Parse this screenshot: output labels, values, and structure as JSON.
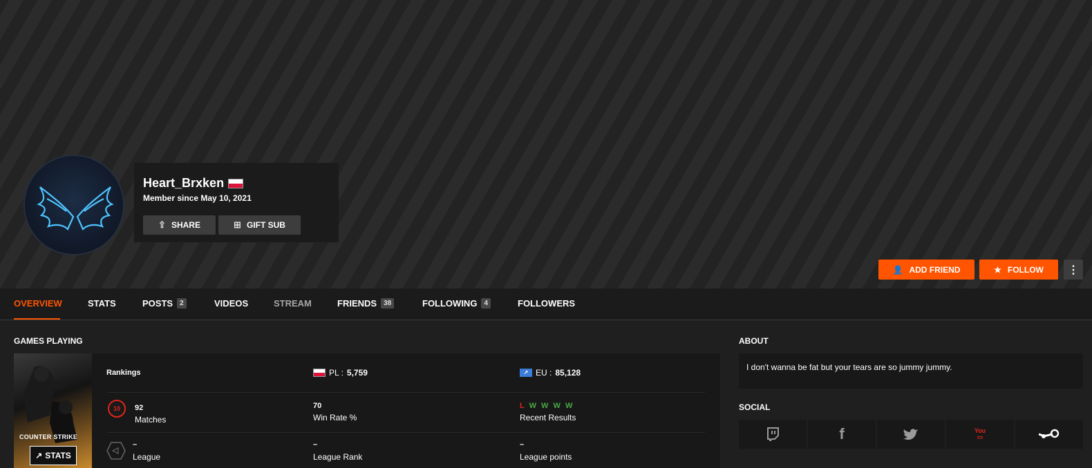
{
  "profile": {
    "username": "Heart_Brxken",
    "member_since": "Member since May 10, 2021",
    "country_flag": "poland-flag-icon",
    "share_label": "SHARE",
    "gift_label": "GIFT SUB"
  },
  "actions": {
    "add_friend_label": "ADD FRIEND",
    "follow_label": "FOLLOW",
    "more_label": "⋮"
  },
  "tabs": [
    {
      "label": "OVERVIEW",
      "active": true
    },
    {
      "label": "STATS"
    },
    {
      "label": "POSTS",
      "count": "2"
    },
    {
      "label": "VIDEOS"
    },
    {
      "label": "STREAM"
    },
    {
      "label": "FRIENDS",
      "count": "38"
    },
    {
      "label": "FOLLOWING",
      "count": "4"
    },
    {
      "label": "FOLLOWERS"
    }
  ],
  "games": {
    "title": "GAMES PLAYING",
    "cover_title": "COUNTER STRIKE",
    "stats_label": "STATS",
    "rankings_label": "Rankings",
    "region_label": "PL :",
    "region_rank": "5,759",
    "eu_badge": "↗",
    "eu_label": "EU :",
    "eu_rank": "85,128",
    "skill_level": "10",
    "matches_value": "92",
    "matches_label": "Matches",
    "winrate_value": "70",
    "winrate_label": "Win Rate %",
    "results": [
      "L",
      "W",
      "W",
      "W",
      "W"
    ],
    "results_label": "Recent Results",
    "league_value": "–",
    "league_label": "League",
    "league_rank_value": "–",
    "league_rank_label": "League Rank",
    "league_points_value": "–",
    "league_points_label": "League points"
  },
  "about": {
    "title": "ABOUT",
    "text": "I don't wanna be fat but your tears are so jummy jummy."
  },
  "social": {
    "title": "SOCIAL",
    "items": [
      "twitch-icon",
      "facebook-icon",
      "twitter-icon",
      "youtube-icon",
      "steam-icon"
    ]
  },
  "colors": {
    "accent": "#ff5500",
    "loss": "#e1251b",
    "win": "#49a942"
  }
}
